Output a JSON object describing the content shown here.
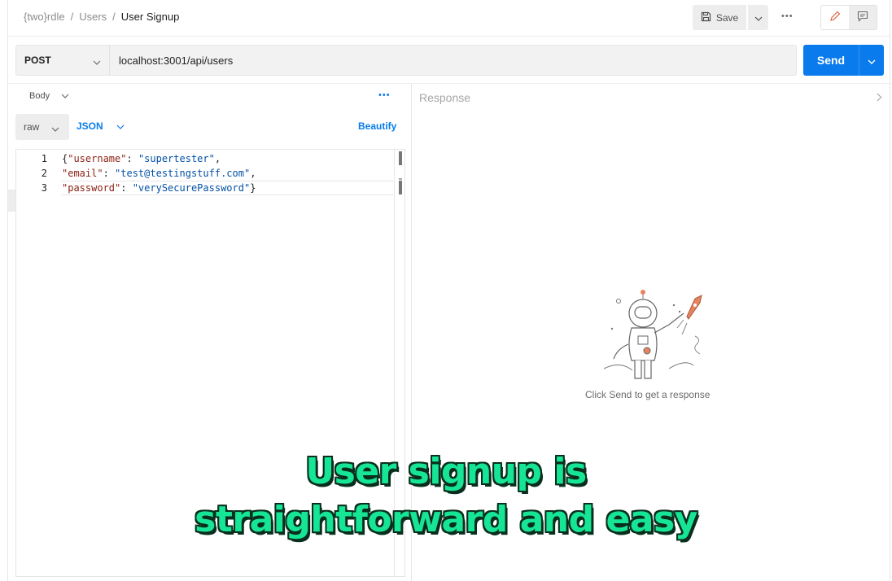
{
  "breadcrumb": {
    "workspace": "{two}rdle",
    "collection": "Users",
    "request": "User Signup",
    "separator": "/"
  },
  "toolbar": {
    "save_label": "Save",
    "more_label": "•••"
  },
  "request": {
    "method": "POST",
    "url": "localhost:3001/api/users",
    "send_label": "Send"
  },
  "body": {
    "tab_label": "Body",
    "more_label": "•••",
    "mode": "raw",
    "format": "JSON",
    "beautify_label": "Beautify",
    "line_numbers": [
      "1",
      "2",
      "3"
    ],
    "lines": [
      {
        "open": "{",
        "key": "\"username\"",
        "colon": ": ",
        "value": "\"supertester\"",
        "close": ","
      },
      {
        "open": "",
        "key": "\"email\"",
        "colon": ": ",
        "value": "\"test@testingstuff.com\"",
        "close": ","
      },
      {
        "open": "",
        "key": "\"password\"",
        "colon": ": ",
        "value": "\"verySecurePassword\"",
        "close": "}"
      }
    ]
  },
  "response": {
    "title": "Response",
    "hint": "Click Send to get a response"
  },
  "caption": {
    "line1": "User signup is",
    "line2": "straightforward and easy"
  },
  "colors": {
    "accent": "#097bed",
    "caption": "#17e596",
    "json_key": "#8a1f11",
    "json_value": "#0451a5"
  }
}
